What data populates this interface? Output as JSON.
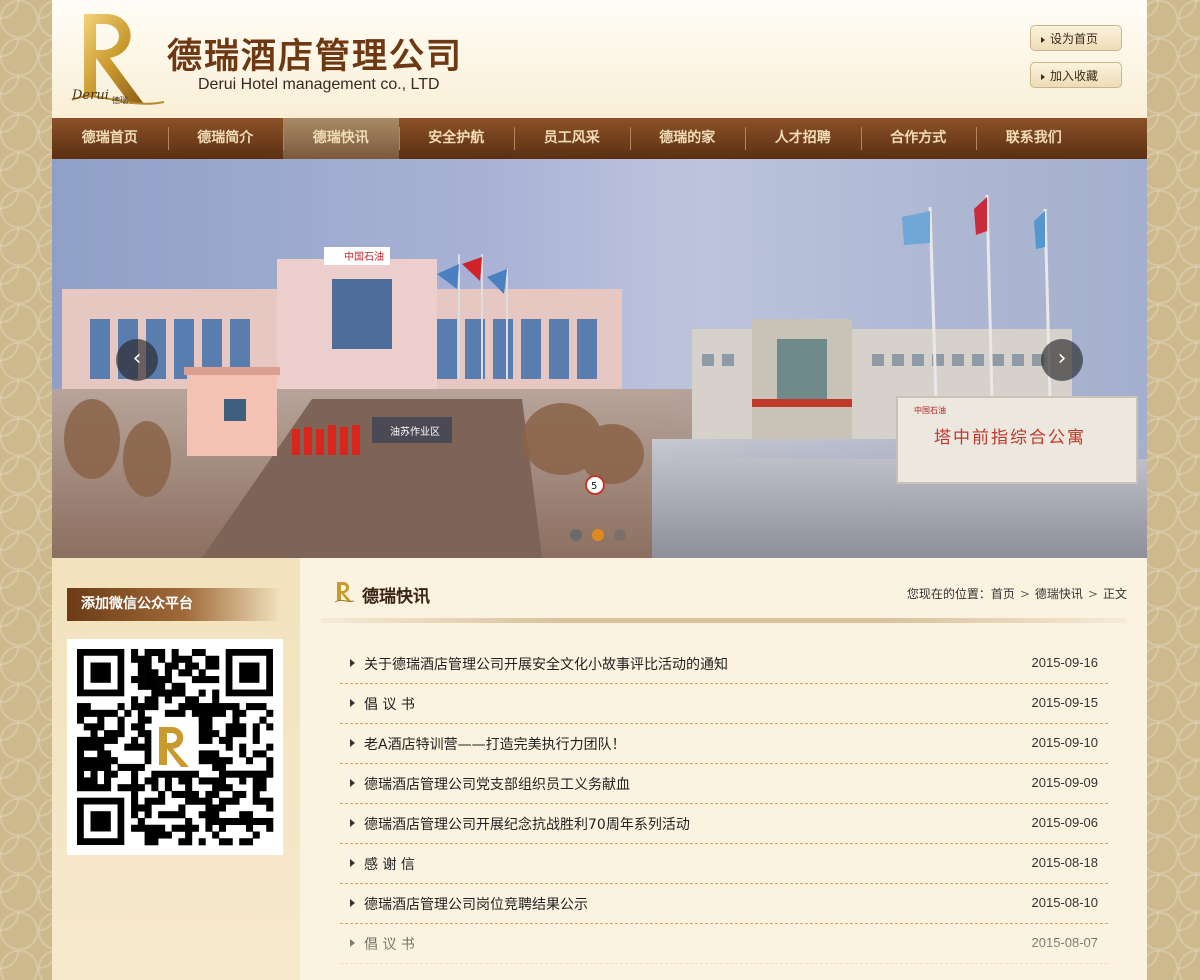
{
  "header": {
    "brand_cn": "德瑞酒店管理公司",
    "brand_en": "Derui Hotel management co., LTD",
    "logo_letter": "R",
    "logo_script": "Derui",
    "logo_small": "德瑞",
    "set_home": "设为首页",
    "add_favorite": "加入收藏"
  },
  "nav": {
    "active_index": 2,
    "items": [
      "德瑞首页",
      "德瑞简介",
      "德瑞快讯",
      "安全护航",
      "员工风采",
      "德瑞的家",
      "人才招聘",
      "合作方式",
      "联系我们"
    ]
  },
  "banner": {
    "left_sign": "中国石油",
    "left_gate_text": "油苏作业区",
    "right_sign_small": "中国石油",
    "right_sign_text": "塔中前指综合公寓",
    "speed_sign": "5",
    "slide_count": 3,
    "active_slide": 1,
    "prev_icon": "chevron-left-icon",
    "next_icon": "chevron-right-icon"
  },
  "sidebar": {
    "wechat_title": "添加微信公众平台"
  },
  "main": {
    "section_title": "德瑞快讯",
    "breadcrumb": {
      "label": "您现在的位置：",
      "items": [
        "首页",
        "德瑞快讯",
        "正文"
      ]
    },
    "news": [
      {
        "title": "关于德瑞酒店管理公司开展安全文化小故事评比活动的通知",
        "date": "2015-09-16"
      },
      {
        "title": "倡 议 书",
        "date": "2015-09-15"
      },
      {
        "title": "老A酒店特训营——打造完美执行力团队！",
        "date": "2015-09-10"
      },
      {
        "title": "德瑞酒店管理公司党支部组织员工义务献血",
        "date": "2015-09-09"
      },
      {
        "title": "德瑞酒店管理公司开展纪念抗战胜利70周年系列活动",
        "date": "2015-09-06"
      },
      {
        "title": "感 谢 信",
        "date": "2015-08-18"
      },
      {
        "title": "德瑞酒店管理公司岗位竞聘结果公示",
        "date": "2015-08-10"
      },
      {
        "title": "倡 议 书",
        "date": "2015-08-07"
      }
    ]
  },
  "colors": {
    "nav_bg": "#6d3b17",
    "brand": "#6d3812",
    "dot_active": "#e08a1e",
    "dot_inactive": "#6b6b6b"
  }
}
